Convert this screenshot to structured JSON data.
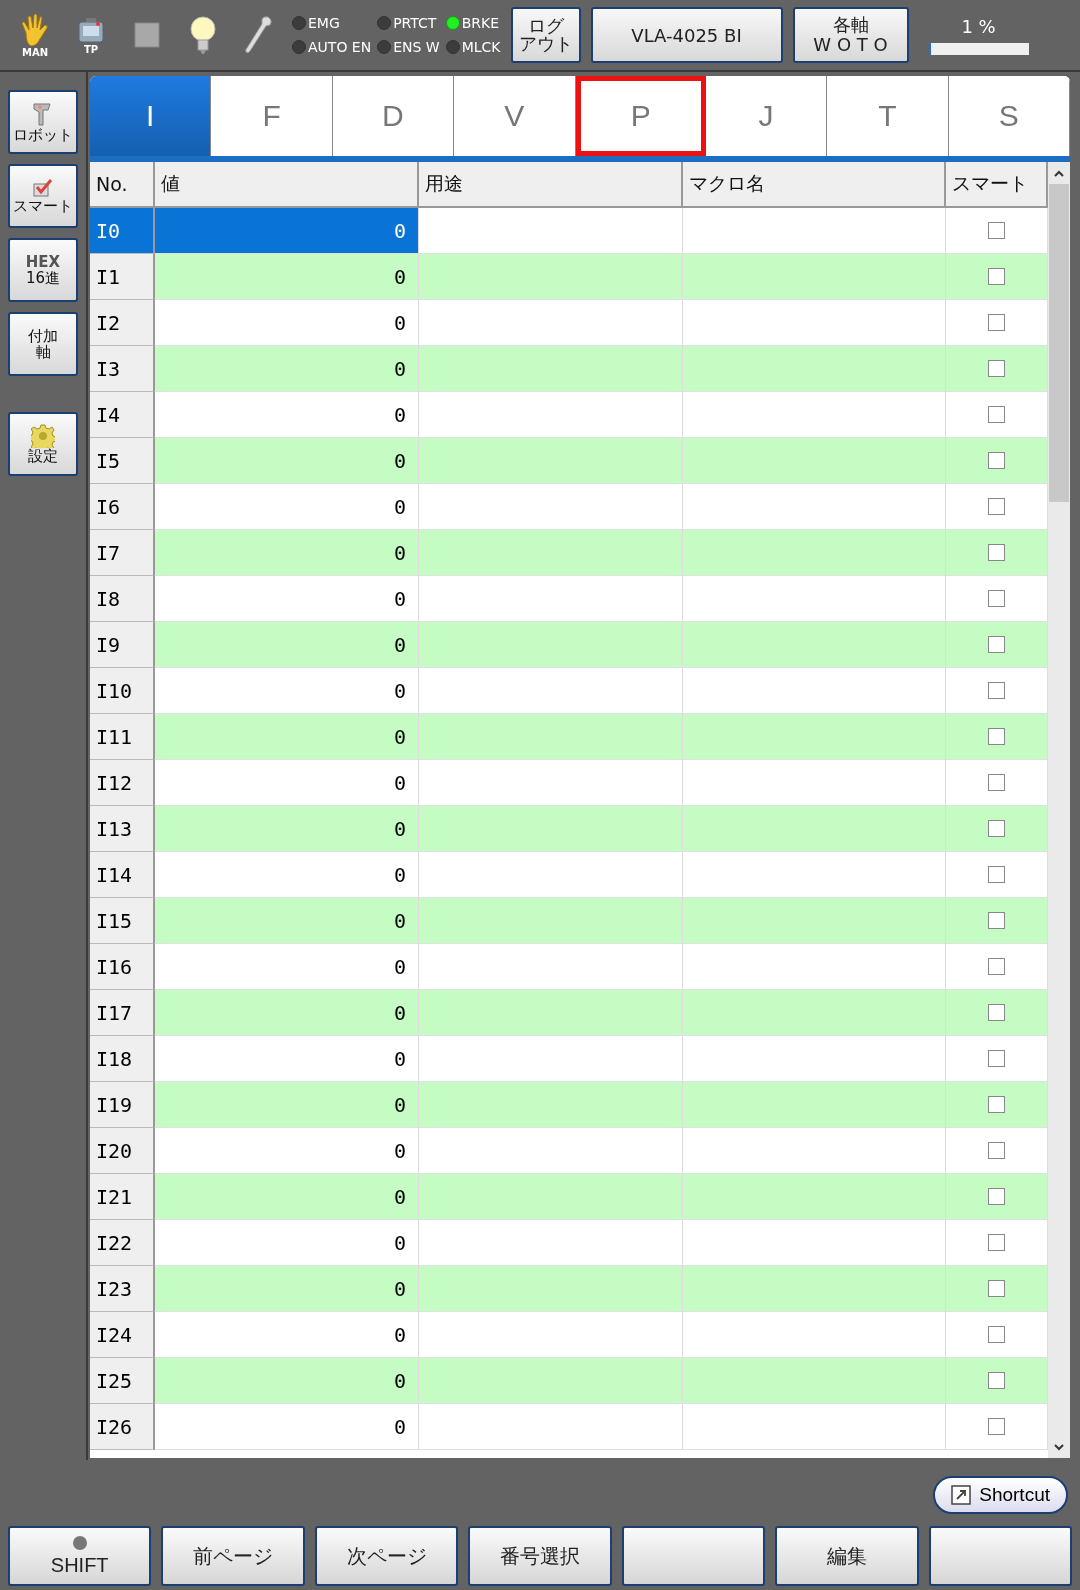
{
  "toolbar": {
    "icons": [
      {
        "kind": "hand",
        "label": "MAN"
      },
      {
        "kind": "pendant",
        "label": "TP"
      },
      {
        "kind": "square"
      },
      {
        "kind": "bulb"
      },
      {
        "kind": "wrench"
      }
    ],
    "lamps": [
      {
        "label": "EMG",
        "on": false
      },
      {
        "label": "PRTCT",
        "on": false
      },
      {
        "label": "BRKE",
        "on": true
      },
      {
        "label": "AUTO EN",
        "on": false
      },
      {
        "label": "ENS W",
        "on": false
      },
      {
        "label": "MLCK",
        "on": false
      }
    ],
    "logout_lines": [
      "ログ",
      "アウト"
    ],
    "robot_button": "VLA-4025 BI",
    "axis_lines": [
      "各軸",
      "W O T O"
    ],
    "progress": {
      "reading": "1 %",
      "level": 0.01
    }
  },
  "sidebar": [
    {
      "kind": "robot",
      "lines": [
        "ロボット"
      ]
    },
    {
      "kind": "smart",
      "lines": [
        "スマート"
      ]
    },
    {
      "kind": "hex",
      "lines": [
        "HEX",
        "16進"
      ]
    },
    {
      "kind": "plain",
      "lines": [
        "付加",
        "軸"
      ]
    },
    {
      "kind": "gear",
      "lines": [
        "設定"
      ]
    }
  ],
  "tabs": [
    {
      "label": "I",
      "selected": true,
      "highlighted": false
    },
    {
      "label": "F",
      "selected": false,
      "highlighted": false
    },
    {
      "label": "D",
      "selected": false,
      "highlighted": false
    },
    {
      "label": "V",
      "selected": false,
      "highlighted": false
    },
    {
      "label": "P",
      "selected": false,
      "highlighted": true
    },
    {
      "label": "J",
      "selected": false,
      "highlighted": false
    },
    {
      "label": "T",
      "selected": false,
      "highlighted": false
    },
    {
      "label": "S",
      "selected": false,
      "highlighted": false
    }
  ],
  "table": {
    "columns": [
      "No.",
      "値",
      "用途",
      "マクロ名",
      "スマート"
    ],
    "rows": [
      {
        "no": "I0",
        "value": "0",
        "smart": false,
        "selected": true
      },
      {
        "no": "I1",
        "value": "0",
        "smart": false,
        "selected": false
      },
      {
        "no": "I2",
        "value": "0",
        "smart": false,
        "selected": false
      },
      {
        "no": "I3",
        "value": "0",
        "smart": false,
        "selected": false
      },
      {
        "no": "I4",
        "value": "0",
        "smart": false,
        "selected": false
      },
      {
        "no": "I5",
        "value": "0",
        "smart": false,
        "selected": false
      },
      {
        "no": "I6",
        "value": "0",
        "smart": false,
        "selected": false
      },
      {
        "no": "I7",
        "value": "0",
        "smart": false,
        "selected": false
      },
      {
        "no": "I8",
        "value": "0",
        "smart": false,
        "selected": false
      },
      {
        "no": "I9",
        "value": "0",
        "smart": false,
        "selected": false
      },
      {
        "no": "I10",
        "value": "0",
        "smart": false,
        "selected": false
      },
      {
        "no": "I11",
        "value": "0",
        "smart": false,
        "selected": false
      },
      {
        "no": "I12",
        "value": "0",
        "smart": false,
        "selected": false
      },
      {
        "no": "I13",
        "value": "0",
        "smart": false,
        "selected": false
      },
      {
        "no": "I14",
        "value": "0",
        "smart": false,
        "selected": false
      },
      {
        "no": "I15",
        "value": "0",
        "smart": false,
        "selected": false
      },
      {
        "no": "I16",
        "value": "0",
        "smart": false,
        "selected": false
      },
      {
        "no": "I17",
        "value": "0",
        "smart": false,
        "selected": false
      },
      {
        "no": "I18",
        "value": "0",
        "smart": false,
        "selected": false
      },
      {
        "no": "I19",
        "value": "0",
        "smart": false,
        "selected": false
      },
      {
        "no": "I20",
        "value": "0",
        "smart": false,
        "selected": false
      },
      {
        "no": "I21",
        "value": "0",
        "smart": false,
        "selected": false
      },
      {
        "no": "I22",
        "value": "0",
        "smart": false,
        "selected": false
      },
      {
        "no": "I23",
        "value": "0",
        "smart": false,
        "selected": false
      },
      {
        "no": "I24",
        "value": "0",
        "smart": false,
        "selected": false
      },
      {
        "no": "I25",
        "value": "0",
        "smart": false,
        "selected": false
      },
      {
        "no": "I26",
        "value": "0",
        "smart": false,
        "selected": false
      }
    ]
  },
  "shortcut": "Shortcut",
  "function_keys": [
    {
      "kind": "shift",
      "label": "SHIFT",
      "lamp_on": false
    },
    {
      "kind": "text",
      "label": "前ページ"
    },
    {
      "kind": "text",
      "label": "次ページ"
    },
    {
      "kind": "text",
      "label": "番号選択"
    },
    {
      "kind": "blank"
    },
    {
      "kind": "text",
      "label": "編集"
    },
    {
      "kind": "blank"
    }
  ]
}
